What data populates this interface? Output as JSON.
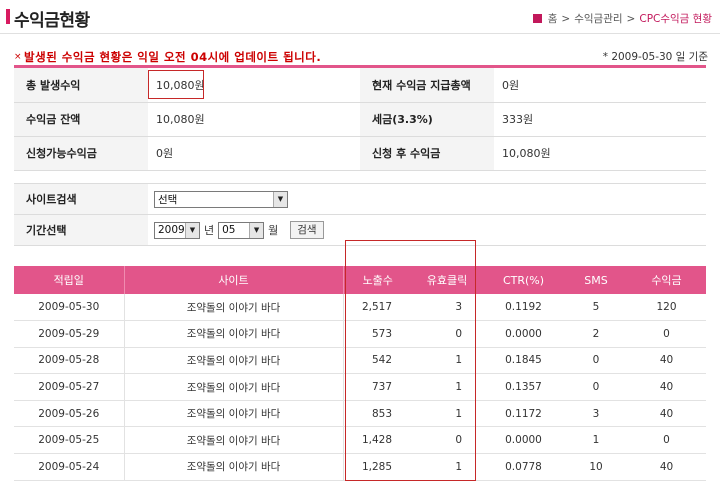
{
  "header": {
    "title": "수익금현황",
    "breadcrumb": [
      "홈",
      "수익금관리",
      "CPC수익금 현황"
    ],
    "breadcrumb_sep": ">"
  },
  "notice": {
    "mark": "×",
    "text": "발생된 수익금 현황은 익일 오전 04시에 업데이트 됩니다.",
    "date_note": "* 2009-05-30 일 기준"
  },
  "summary": {
    "rows": [
      {
        "label1": "총 발생수익",
        "value1": "10,080원",
        "label2": "현재 수익금 지급총액",
        "value2": "0원"
      },
      {
        "label1": "수익금 잔액",
        "value1": "10,080원",
        "label2": "세금(3.3%)",
        "value2": "333원"
      },
      {
        "label1": "신청가능수익금",
        "value1": "0원",
        "label2": "신청 후 수익금",
        "value2": "10,080원"
      }
    ]
  },
  "filters": {
    "site_label": "사이트검색",
    "site_value": "선택",
    "period_label": "기간선택",
    "year_value": "2009",
    "year_unit": "년",
    "month_value": "05",
    "month_unit": "월",
    "search_button": "검색",
    "dropdown_arrow": "▼"
  },
  "table": {
    "headers": [
      "적립일",
      "사이트",
      "노출수",
      "유효클릭",
      "CTR(%)",
      "SMS",
      "수익금"
    ],
    "rows": [
      [
        "2009-05-30",
        "조약돌의 이야기 바다",
        "2,517",
        "3",
        "0.1192",
        "5",
        "120"
      ],
      [
        "2009-05-29",
        "조약돌의 이야기 바다",
        "573",
        "0",
        "0.0000",
        "2",
        "0"
      ],
      [
        "2009-05-28",
        "조약돌의 이야기 바다",
        "542",
        "1",
        "0.1845",
        "0",
        "40"
      ],
      [
        "2009-05-27",
        "조약돌의 이야기 바다",
        "737",
        "1",
        "0.1357",
        "0",
        "40"
      ],
      [
        "2009-05-26",
        "조약돌의 이야기 바다",
        "853",
        "1",
        "0.1172",
        "3",
        "40"
      ],
      [
        "2009-05-25",
        "조약돌의 이야기 바다",
        "1,428",
        "0",
        "0.0000",
        "1",
        "0"
      ],
      [
        "2009-05-24",
        "조약돌의 이야기 바다",
        "1,285",
        "1",
        "0.0778",
        "10",
        "40"
      ]
    ]
  },
  "colors": {
    "accent": "#e2558a",
    "highlight_box": "#c62828",
    "notice_text": "#cc0000"
  }
}
